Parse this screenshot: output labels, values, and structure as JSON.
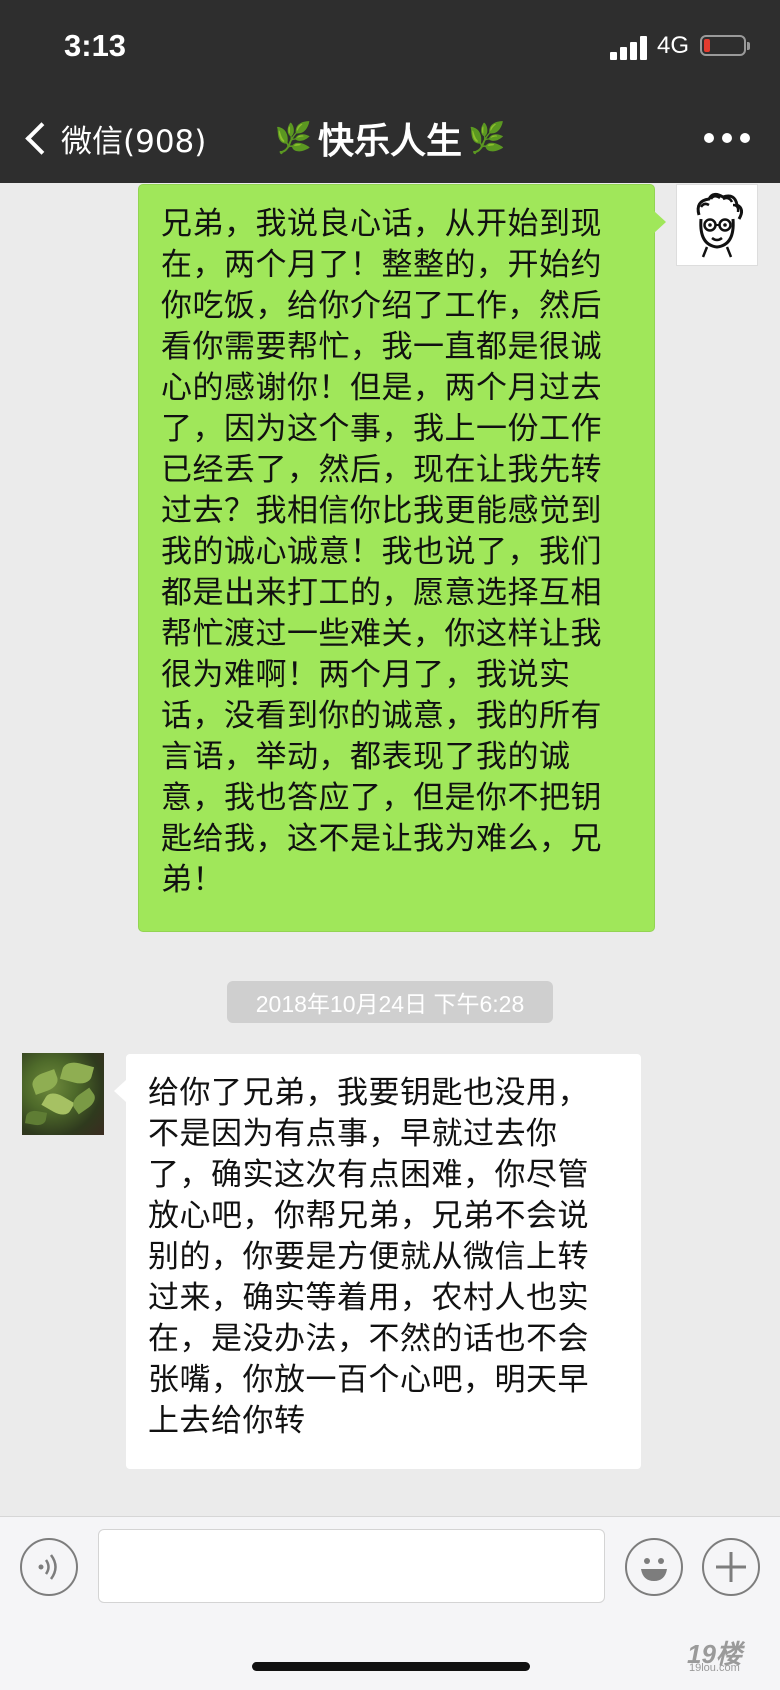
{
  "status_bar": {
    "time": "3:13",
    "network": "4G",
    "battery_level": 0.15
  },
  "nav": {
    "back_label": "微信(908)",
    "title": "快乐人生",
    "title_decoration": "🌿",
    "more_icon": "more-dots-icon"
  },
  "messages": [
    {
      "side": "sent",
      "lines": [
        "兄弟，我说良心话，从开始到现",
        "在，两个月了！整整的，开始约",
        "你吃饭，给你介绍了工作，然后",
        "看你需要帮忙，我一直都是很诚",
        "心的感谢你！但是，两个月过去",
        "了，因为这个事，我上一份工作",
        "已经丢了，然后，现在让我先转",
        "过去？我相信你比我更能感觉到",
        "我的诚心诚意！我也说了，我们",
        "都是出来打工的，愿意选择互相",
        "帮忙渡过一些难关，你这样让我",
        "很为难啊！两个月了，我说实",
        "话，没看到你的诚意，我的所有",
        "言语，举动，都表现了我的诚",
        "意，我也答应了，但是你不把钥",
        "匙给我，这不是让我为难么，兄",
        "弟！"
      ]
    },
    {
      "side": "received",
      "lines": [
        "给你了兄弟，我要钥匙也没用，",
        "不是因为有点事，早就过去你",
        "了，确实这次有点困难，你尽管",
        "放心吧，你帮兄弟，兄弟不会说",
        "别的，你要是方便就从微信上转",
        "过来，确实等着用，农村人也实",
        "在，是没办法，不然的话也不会",
        "张嘴，你放一百个心吧，明天早",
        "上去给你转"
      ]
    }
  ],
  "timestamp": "2018年10月24日 下午6:28",
  "input_bar": {
    "voice_icon": "voice-icon",
    "emoji_icon": "emoji-icon",
    "plus_icon": "plus-icon",
    "text_value": ""
  },
  "watermark": {
    "main": "19楼",
    "sub": "19lou.com"
  },
  "colors": {
    "sent_bubble": "#a0e75a",
    "received_bubble": "#ffffff",
    "nav_bg": "#2e2e2e",
    "chat_bg": "#ebebeb"
  }
}
